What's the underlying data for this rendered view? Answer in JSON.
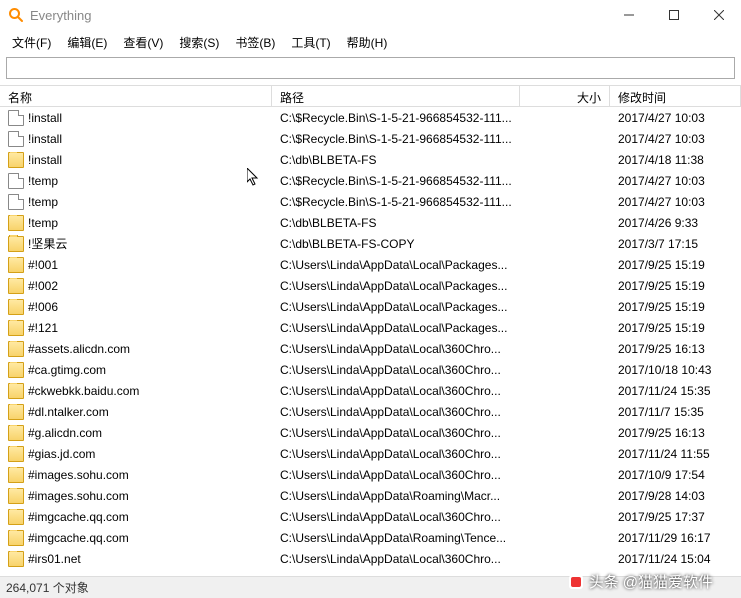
{
  "window": {
    "title": "Everything"
  },
  "menu": [
    {
      "label": "文件(F)"
    },
    {
      "label": "编辑(E)"
    },
    {
      "label": "查看(V)"
    },
    {
      "label": "搜索(S)"
    },
    {
      "label": "书签(B)"
    },
    {
      "label": "工具(T)"
    },
    {
      "label": "帮助(H)"
    }
  ],
  "search": {
    "value": "",
    "placeholder": ""
  },
  "columns": {
    "name": "名称",
    "path": "路径",
    "size": "大小",
    "mtime": "修改时间"
  },
  "rows": [
    {
      "icon": "file",
      "name": "!install",
      "path": "C:\\$Recycle.Bin\\S-1-5-21-966854532-111...",
      "size": "",
      "mtime": "2017/4/27 10:03"
    },
    {
      "icon": "file",
      "name": "!install",
      "path": "C:\\$Recycle.Bin\\S-1-5-21-966854532-111...",
      "size": "",
      "mtime": "2017/4/27 10:03"
    },
    {
      "icon": "folder",
      "name": "!install",
      "path": "C:\\db\\BLBETA-FS",
      "size": "",
      "mtime": "2017/4/18 11:38"
    },
    {
      "icon": "file",
      "name": "!temp",
      "path": "C:\\$Recycle.Bin\\S-1-5-21-966854532-111...",
      "size": "",
      "mtime": "2017/4/27 10:03"
    },
    {
      "icon": "file",
      "name": "!temp",
      "path": "C:\\$Recycle.Bin\\S-1-5-21-966854532-111...",
      "size": "",
      "mtime": "2017/4/27 10:03"
    },
    {
      "icon": "folder",
      "name": "!temp",
      "path": "C:\\db\\BLBETA-FS",
      "size": "",
      "mtime": "2017/4/26 9:33"
    },
    {
      "icon": "folder",
      "name": "!坚果云",
      "path": "C:\\db\\BLBETA-FS-COPY",
      "size": "",
      "mtime": "2017/3/7 17:15"
    },
    {
      "icon": "folder",
      "name": "#!001",
      "path": "C:\\Users\\Linda\\AppData\\Local\\Packages...",
      "size": "",
      "mtime": "2017/9/25 15:19"
    },
    {
      "icon": "folder",
      "name": "#!002",
      "path": "C:\\Users\\Linda\\AppData\\Local\\Packages...",
      "size": "",
      "mtime": "2017/9/25 15:19"
    },
    {
      "icon": "folder",
      "name": "#!006",
      "path": "C:\\Users\\Linda\\AppData\\Local\\Packages...",
      "size": "",
      "mtime": "2017/9/25 15:19"
    },
    {
      "icon": "folder",
      "name": "#!121",
      "path": "C:\\Users\\Linda\\AppData\\Local\\Packages...",
      "size": "",
      "mtime": "2017/9/25 15:19"
    },
    {
      "icon": "folder",
      "name": "#assets.alicdn.com",
      "path": "C:\\Users\\Linda\\AppData\\Local\\360Chro...",
      "size": "",
      "mtime": "2017/9/25 16:13"
    },
    {
      "icon": "folder",
      "name": "#ca.gtimg.com",
      "path": "C:\\Users\\Linda\\AppData\\Local\\360Chro...",
      "size": "",
      "mtime": "2017/10/18 10:43"
    },
    {
      "icon": "folder",
      "name": "#ckwebkk.baidu.com",
      "path": "C:\\Users\\Linda\\AppData\\Local\\360Chro...",
      "size": "",
      "mtime": "2017/11/24 15:35"
    },
    {
      "icon": "folder",
      "name": "#dl.ntalker.com",
      "path": "C:\\Users\\Linda\\AppData\\Local\\360Chro...",
      "size": "",
      "mtime": "2017/11/7 15:35"
    },
    {
      "icon": "folder",
      "name": "#g.alicdn.com",
      "path": "C:\\Users\\Linda\\AppData\\Local\\360Chro...",
      "size": "",
      "mtime": "2017/9/25 16:13"
    },
    {
      "icon": "folder",
      "name": "#gias.jd.com",
      "path": "C:\\Users\\Linda\\AppData\\Local\\360Chro...",
      "size": "",
      "mtime": "2017/11/24 11:55"
    },
    {
      "icon": "folder",
      "name": "#images.sohu.com",
      "path": "C:\\Users\\Linda\\AppData\\Local\\360Chro...",
      "size": "",
      "mtime": "2017/10/9 17:54"
    },
    {
      "icon": "folder",
      "name": "#images.sohu.com",
      "path": "C:\\Users\\Linda\\AppData\\Roaming\\Macr...",
      "size": "",
      "mtime": "2017/9/28 14:03"
    },
    {
      "icon": "folder",
      "name": "#imgcache.qq.com",
      "path": "C:\\Users\\Linda\\AppData\\Local\\360Chro...",
      "size": "",
      "mtime": "2017/9/25 17:37"
    },
    {
      "icon": "folder",
      "name": "#imgcache.qq.com",
      "path": "C:\\Users\\Linda\\AppData\\Roaming\\Tence...",
      "size": "",
      "mtime": "2017/11/29 16:17"
    },
    {
      "icon": "folder",
      "name": "#irs01.net",
      "path": "C:\\Users\\Linda\\AppData\\Local\\360Chro...",
      "size": "",
      "mtime": "2017/11/24 15:04"
    }
  ],
  "status": {
    "text": "264,071 个对象"
  },
  "watermark": {
    "prefix": "头条",
    "account": "@猫猫爱软件"
  },
  "colors": {
    "accent": "#ff8c00"
  }
}
